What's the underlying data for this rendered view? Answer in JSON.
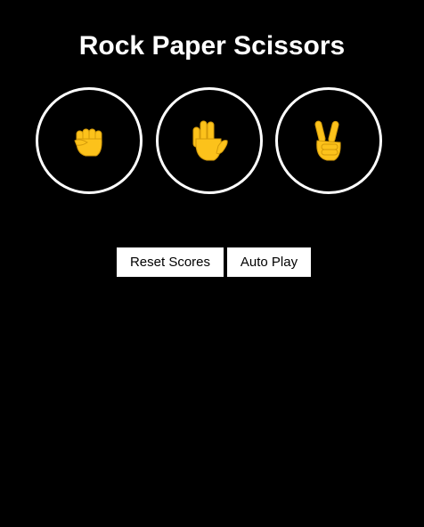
{
  "page": {
    "title": "Rock Paper Scissors"
  },
  "choices": [
    {
      "name": "rock",
      "icon": "raised-fist-icon"
    },
    {
      "name": "paper",
      "icon": "raised-hand-icon"
    },
    {
      "name": "scissors",
      "icon": "victory-hand-icon"
    }
  ],
  "controls": {
    "reset_label": "Reset Scores",
    "auto_play_label": "Auto Play"
  },
  "colors": {
    "background": "#000000",
    "text": "#ffffff",
    "ring": "#ffffff",
    "emoji": "#fcc21b",
    "button_bg": "#ffffff",
    "button_text": "#000000"
  }
}
